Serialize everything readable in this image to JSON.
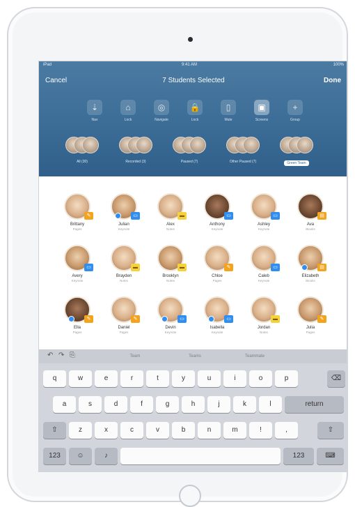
{
  "status": {
    "carrier": "iPad",
    "time": "9:41 AM",
    "battery": "100%"
  },
  "nav": {
    "cancel": "Cancel",
    "title": "7 Students Selected",
    "done": "Done"
  },
  "actions": [
    {
      "label": "Nav",
      "icon": "⇣",
      "name": "navigate-icon"
    },
    {
      "label": "Lock",
      "icon": "⌂",
      "name": "launch-icon"
    },
    {
      "label": "Navigate",
      "icon": "◎",
      "name": "compass-icon"
    },
    {
      "label": "Lock",
      "icon": "🔒",
      "name": "lock-icon"
    },
    {
      "label": "Mute",
      "icon": "▯",
      "name": "mute-icon"
    },
    {
      "label": "Screens",
      "icon": "▣",
      "name": "screens-icon"
    },
    {
      "label": "Group",
      "icon": "+",
      "name": "add-group-icon"
    }
  ],
  "groups": [
    {
      "label": "All (30)"
    },
    {
      "label": "Recorded (3)"
    },
    {
      "label": "Paused (7)"
    },
    {
      "label": "Other Paused (7)"
    },
    {
      "label": "Green Team"
    }
  ],
  "students": [
    {
      "name": "Brittany",
      "sub": "Pages",
      "badge": "orange",
      "icon": "✎",
      "check": false,
      "skin": "light"
    },
    {
      "name": "Julian",
      "sub": "Keynote",
      "badge": "blue",
      "icon": "▭",
      "check": true,
      "skin": "tan"
    },
    {
      "name": "Alex",
      "sub": "Notes",
      "badge": "yellow",
      "icon": "▬",
      "check": false,
      "skin": "light"
    },
    {
      "name": "Anthony",
      "sub": "Keynote",
      "badge": "blue",
      "icon": "▭",
      "check": false,
      "skin": "dark"
    },
    {
      "name": "Ashley",
      "sub": "Keynote",
      "badge": "blue",
      "icon": "▭",
      "check": false,
      "skin": "light"
    },
    {
      "name": "Ava",
      "sub": "iBooks",
      "badge": "orange",
      "icon": "▤",
      "check": false,
      "skin": "dark"
    },
    {
      "name": "Avery",
      "sub": "Keynote",
      "badge": "blue",
      "icon": "▭",
      "check": false,
      "skin": "tan"
    },
    {
      "name": "Brayden",
      "sub": "Notes",
      "badge": "yellow",
      "icon": "▬",
      "check": false,
      "skin": "light"
    },
    {
      "name": "Brooklyn",
      "sub": "Notes",
      "badge": "yellow",
      "icon": "▬",
      "check": false,
      "skin": "tan"
    },
    {
      "name": "Chloe",
      "sub": "Pages",
      "badge": "orange",
      "icon": "✎",
      "check": false,
      "skin": "light"
    },
    {
      "name": "Caleb",
      "sub": "Keynote",
      "badge": "blue",
      "icon": "▭",
      "check": false,
      "skin": "light"
    },
    {
      "name": "Elizabeth",
      "sub": "iBooks",
      "badge": "orange",
      "icon": "▤",
      "check": true,
      "skin": "tan"
    },
    {
      "name": "Ella",
      "sub": "Pages",
      "badge": "orange",
      "icon": "✎",
      "check": true,
      "skin": "dark"
    },
    {
      "name": "Daniel",
      "sub": "Pages",
      "badge": "orange",
      "icon": "✎",
      "check": false,
      "skin": "light"
    },
    {
      "name": "Devin",
      "sub": "Keynote",
      "badge": "blue",
      "icon": "▭",
      "check": true,
      "skin": "light"
    },
    {
      "name": "Isabella",
      "sub": "Keynote",
      "badge": "blue",
      "icon": "▭",
      "check": true,
      "skin": "light"
    },
    {
      "name": "Jordan",
      "sub": "Notes",
      "badge": "yellow",
      "icon": "▬",
      "check": false,
      "skin": "light"
    },
    {
      "name": "Julia",
      "sub": "Pages",
      "badge": "orange",
      "icon": "✎",
      "check": false,
      "skin": "tan"
    }
  ],
  "keyboard": {
    "suggestions": [
      "Team",
      "Teams",
      "Teammate"
    ],
    "row1": [
      "q",
      "w",
      "e",
      "r",
      "t",
      "y",
      "u",
      "i",
      "o",
      "p"
    ],
    "row2": [
      "a",
      "s",
      "d",
      "f",
      "g",
      "h",
      "j",
      "k",
      "l"
    ],
    "row3": [
      "z",
      "x",
      "c",
      "v",
      "b",
      "n",
      "m",
      "!",
      ","
    ],
    "return": "return",
    "numbers": "123"
  },
  "colors": {
    "header": "#3c6d96",
    "badge_blue": "#2f8ef0",
    "badge_orange": "#f2a41f",
    "keyboard": "#d2d5db"
  }
}
